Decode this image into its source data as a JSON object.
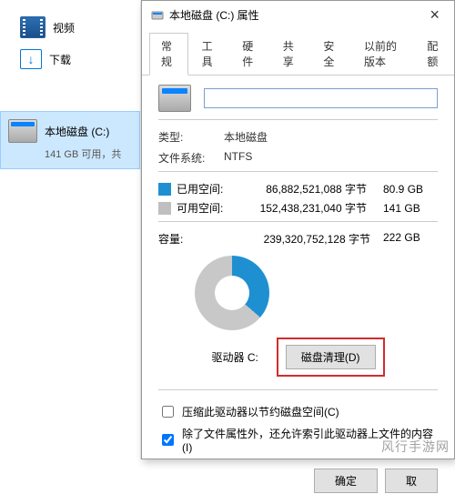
{
  "explorer": {
    "videos_label": "视频",
    "downloads_label": "下载",
    "drive_title": "本地磁盘 (C:)",
    "drive_sub": "141 GB 可用，共"
  },
  "dialog": {
    "title": "本地磁盘 (C:) 属性",
    "close_glyph": "×",
    "tabs": {
      "general": "常规",
      "tools": "工具",
      "hardware": "硬件",
      "sharing": "共享",
      "security": "安全",
      "previous": "以前的版本",
      "quota": "配额"
    },
    "name_value": "",
    "type_label": "类型:",
    "type_value": "本地磁盘",
    "fs_label": "文件系统:",
    "fs_value": "NTFS",
    "used_label": "已用空间:",
    "used_bytes": "86,882,521,088 字节",
    "used_gb": "80.9 GB",
    "free_label": "可用空间:",
    "free_bytes": "152,438,231,040 字节",
    "free_gb": "141 GB",
    "cap_label": "容量:",
    "cap_bytes": "239,320,752,128 字节",
    "cap_gb": "222 GB",
    "drive_c_label": "驱动器 C:",
    "cleanup_btn": "磁盘清理(D)",
    "compress_label": "压缩此驱动器以节约磁盘空间(C)",
    "index_label": "除了文件属性外，还允许索引此驱动器上文件的内容(I)",
    "ok": "确定",
    "cancel": "取"
  },
  "watermark": "风行手游网"
}
